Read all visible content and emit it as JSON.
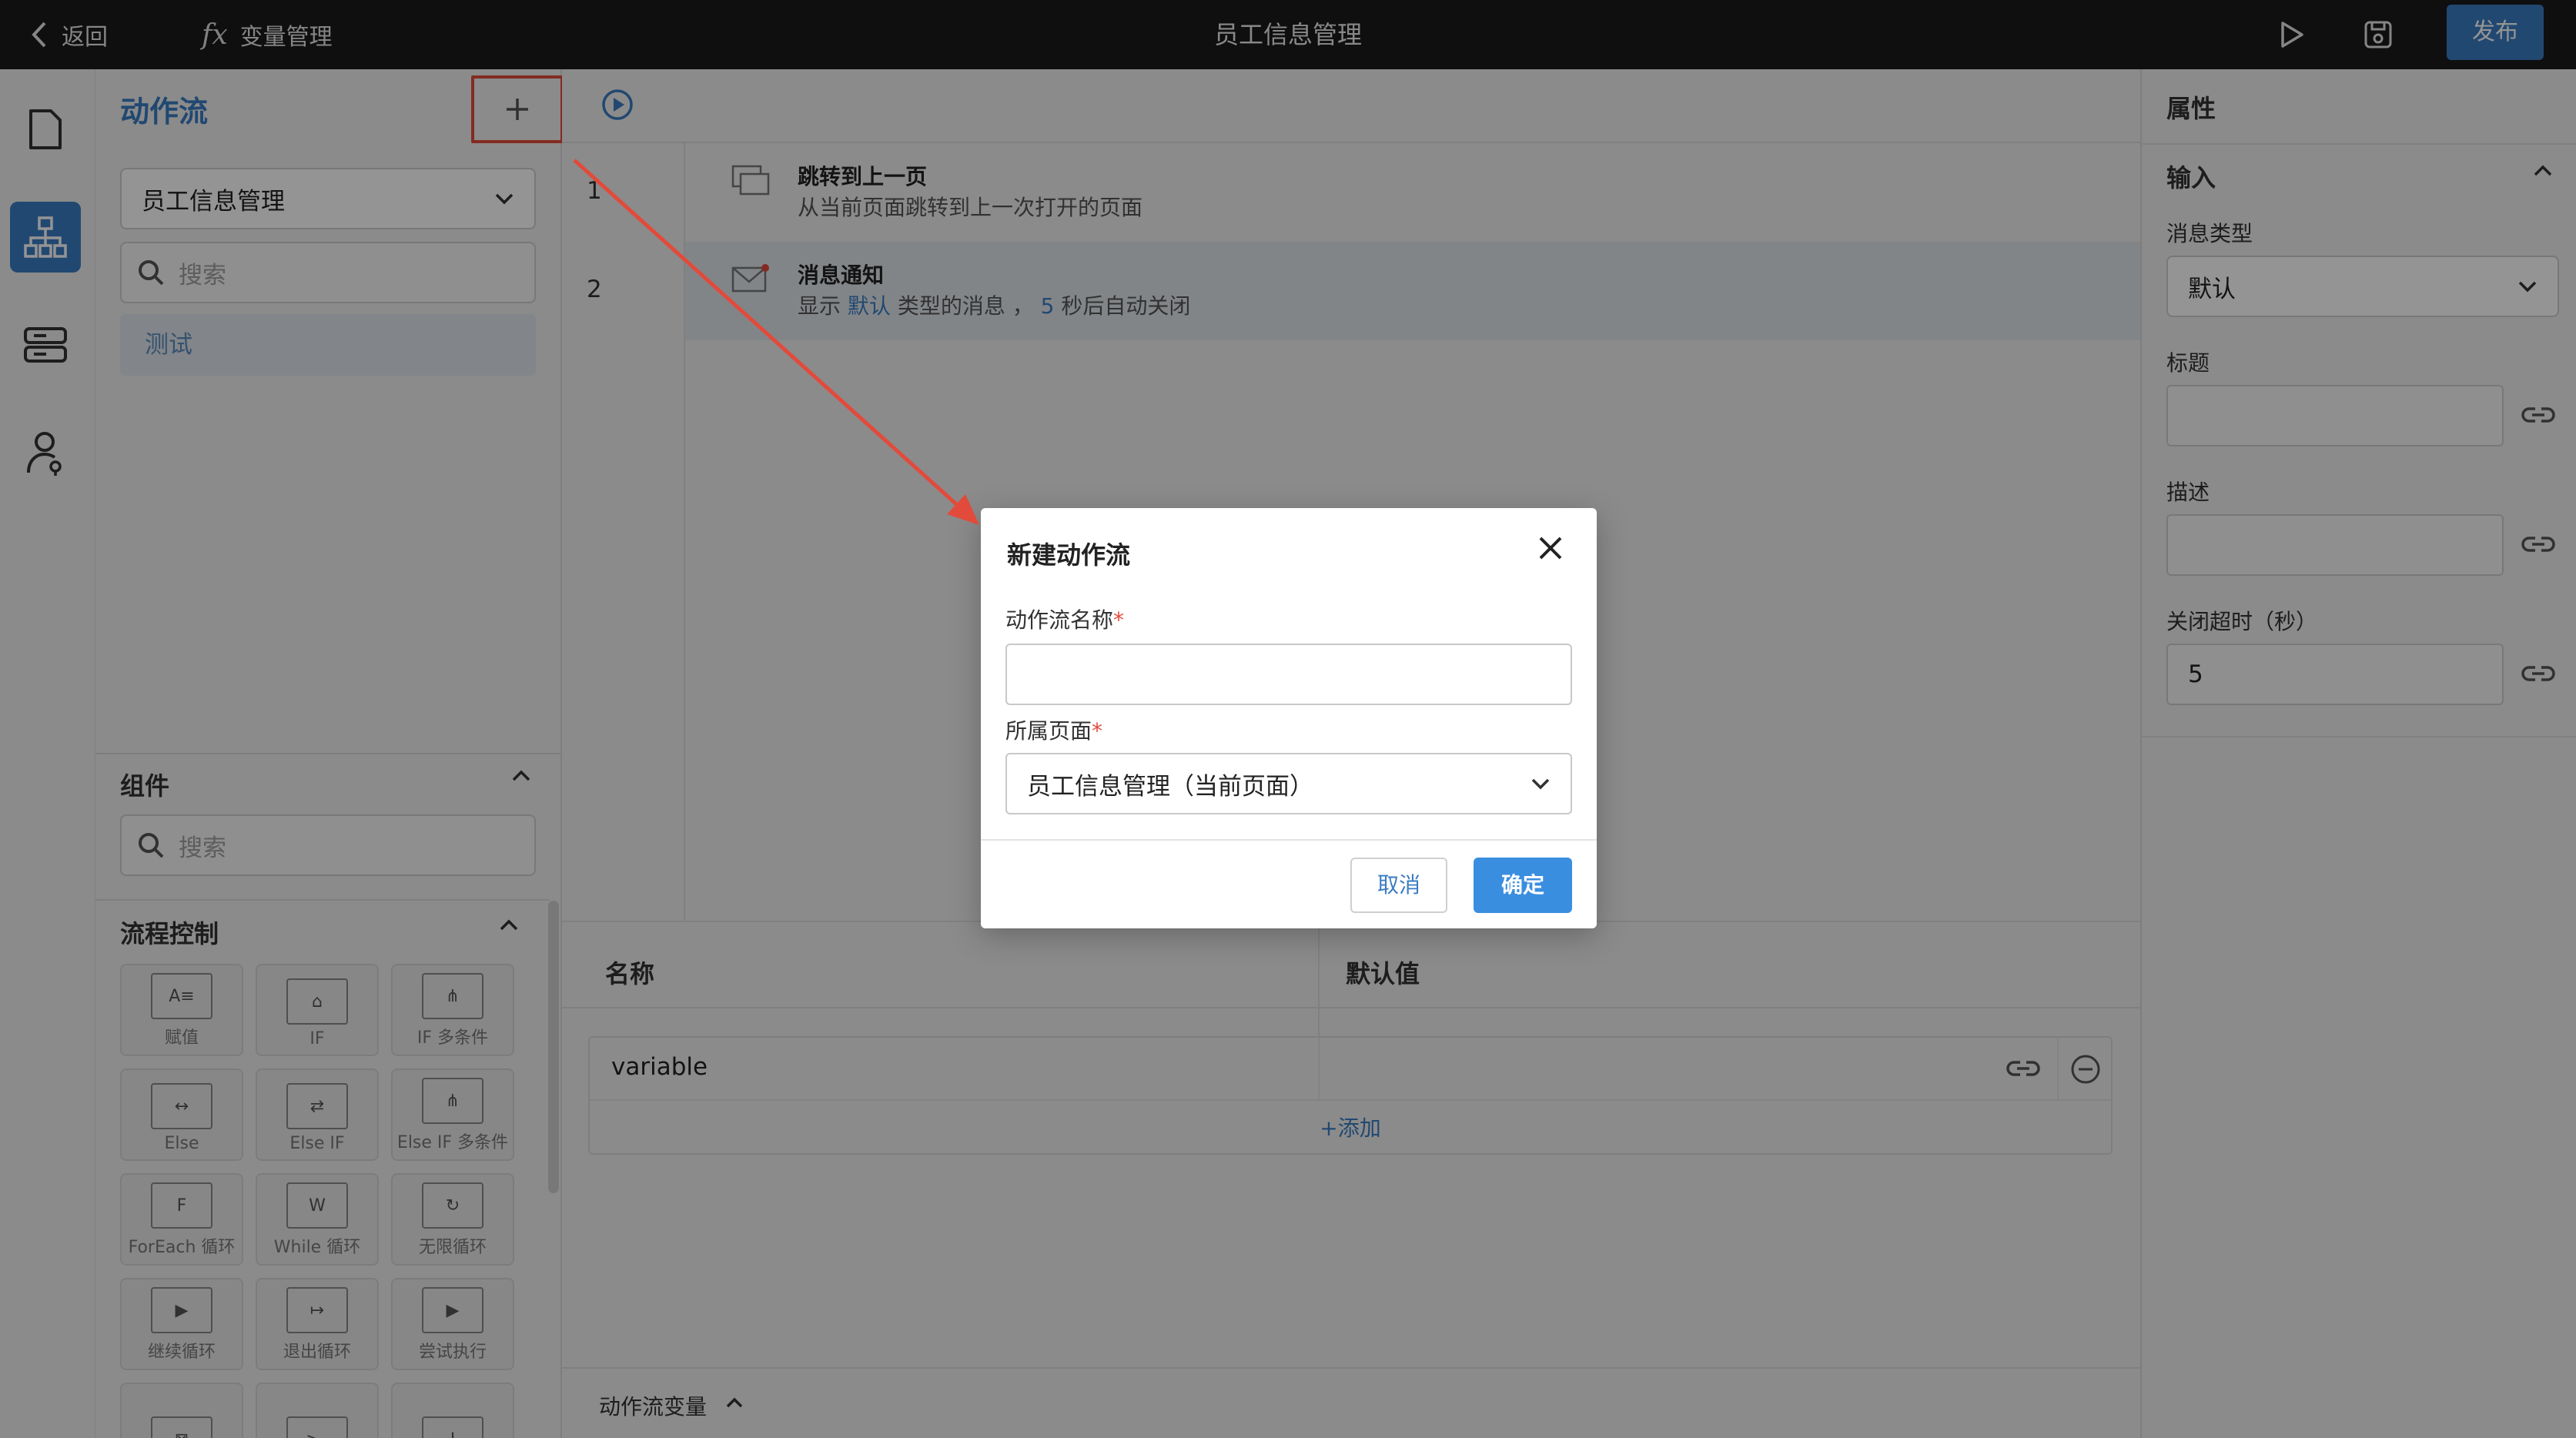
{
  "topbar": {
    "back_label": "返回",
    "fx_symbol": "fx",
    "vars_label": "变量管理",
    "title": "员工信息管理",
    "publish_label": "发布"
  },
  "rail": {
    "items": [
      {
        "icon": "page-icon"
      },
      {
        "icon": "flow-icon",
        "active": true
      },
      {
        "icon": "data-icon"
      },
      {
        "icon": "user-icon"
      }
    ]
  },
  "flow_panel": {
    "title": "动作流",
    "page_select": "员工信息管理",
    "search_placeholder": "搜索",
    "flows": [
      "测试"
    ]
  },
  "components": {
    "title": "组件",
    "search_placeholder": "搜索",
    "flow_control_title": "流程控制",
    "tiles": [
      {
        "label": "赋值",
        "glyph": "A≡"
      },
      {
        "label": "IF",
        "glyph": "⌂"
      },
      {
        "label": "IF 多条件",
        "glyph": "⋔"
      },
      {
        "label": "Else",
        "glyph": "↔"
      },
      {
        "label": "Else IF",
        "glyph": "⇄"
      },
      {
        "label": "Else IF 多条件",
        "glyph": "⋔"
      },
      {
        "label": "ForEach 循环",
        "glyph": "F"
      },
      {
        "label": "While 循环",
        "glyph": "W"
      },
      {
        "label": "无限循环",
        "glyph": "↻"
      },
      {
        "label": "继续循环",
        "glyph": "▶"
      },
      {
        "label": "退出循环",
        "glyph": "↦"
      },
      {
        "label": "尝试执行",
        "glyph": "▶"
      },
      {
        "label": "",
        "glyph": "⊠"
      },
      {
        "label": "",
        "glyph": ">_"
      },
      {
        "label": "",
        "glyph": "!"
      }
    ]
  },
  "steps": [
    {
      "num": "1",
      "title": "跳转到上一页",
      "desc": "从当前页面跳转到上一次打开的页面"
    },
    {
      "num": "2",
      "title": "消息通知",
      "desc_pre": "显示",
      "desc_type": "默认",
      "desc_mid": "类型的消息 ，",
      "desc_secs": "5",
      "desc_post": "秒后自动关闭"
    }
  ],
  "variables": {
    "col_name": "名称",
    "col_default": "默认值",
    "rows": [
      {
        "name": "variable",
        "default": ""
      }
    ],
    "add_label": "+添加",
    "footer_label": "动作流变量"
  },
  "props": {
    "title": "属性",
    "section": "输入",
    "msg_type_label": "消息类型",
    "msg_type_value": "默认",
    "title_label": "标题",
    "title_value": "",
    "desc_label": "描述",
    "desc_value": "",
    "timeout_label": "关闭超时（秒）",
    "timeout_value": "5"
  },
  "dialog": {
    "title": "新建动作流",
    "name_label": "动作流名称",
    "page_label": "所属页面",
    "required_mark": "*",
    "name_value": "",
    "page_value": "员工信息管理（当前页面）",
    "cancel_label": "取消",
    "ok_label": "确定"
  },
  "colors": {
    "accent": "#3a7cc3",
    "annotation": "#e24a3b",
    "topbar": "#1b1b1c"
  }
}
